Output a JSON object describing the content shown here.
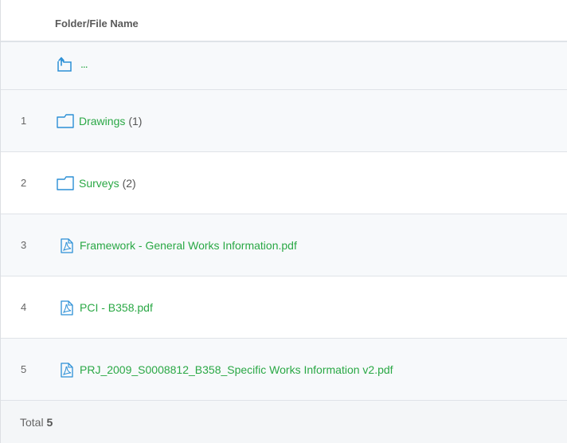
{
  "header": {
    "name_column": "Folder/File Name"
  },
  "parent_row": {
    "icon": "folder-up-icon",
    "label": "..."
  },
  "rows": [
    {
      "index": "1",
      "type": "folder",
      "icon": "folder-icon",
      "name": "Drawings",
      "count": "(1)"
    },
    {
      "index": "2",
      "type": "folder",
      "icon": "folder-icon",
      "name": "Surveys",
      "count": "(2)"
    },
    {
      "index": "3",
      "type": "file",
      "icon": "pdf-file-icon",
      "name": "Framework - General Works Information.pdf"
    },
    {
      "index": "4",
      "type": "file",
      "icon": "pdf-file-icon",
      "name": "PCI - B358.pdf"
    },
    {
      "index": "5",
      "type": "file",
      "icon": "pdf-file-icon",
      "name": "PRJ_2009_S0008812_B358_Specific Works Information v2.pdf"
    }
  ],
  "footer": {
    "total_label": "Total",
    "total_value": "5"
  },
  "colors": {
    "link": "#2aa845",
    "icon": "#2b8fd6",
    "row_alt": "#f7f9fb",
    "border": "#dfe3e8"
  }
}
